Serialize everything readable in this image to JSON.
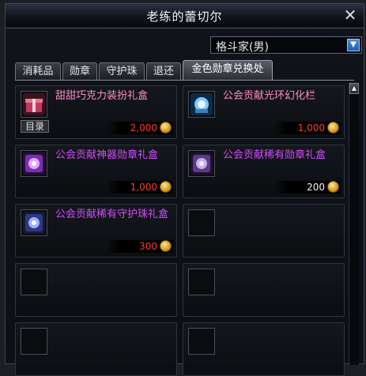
{
  "window": {
    "title": "老练的蕾切尔",
    "close_symbol": "✕"
  },
  "class_select": {
    "value": "格斗家(男)"
  },
  "tabs": [
    {
      "label": "消耗品"
    },
    {
      "label": "勋章"
    },
    {
      "label": "守护珠"
    },
    {
      "label": "退还"
    },
    {
      "label": "金色勋章兑换处"
    }
  ],
  "items": [
    {
      "name": "甜甜巧克力装扮礼盒",
      "price": "2,000",
      "tag": "目录",
      "icon": "chocolate-gift-icon"
    },
    {
      "name": "公会贡献光环幻化栏",
      "price": "1,000",
      "icon": "aura-slot-icon"
    },
    {
      "name": "公会贡献神器勋章礼盒",
      "price": "1,000",
      "icon": "artifact-medal-box-icon"
    },
    {
      "name": "公会贡献稀有勋章礼盒",
      "price": "200",
      "icon": "rare-medal-box-icon"
    },
    {
      "name": "公会贡献稀有守护珠礼盒",
      "price": "300",
      "icon": "rare-guardian-orb-box-icon"
    }
  ],
  "colors": {
    "price_red": "#ff3b30",
    "name_pink": "#ff8cc8",
    "name_purple": "#d14bff"
  }
}
